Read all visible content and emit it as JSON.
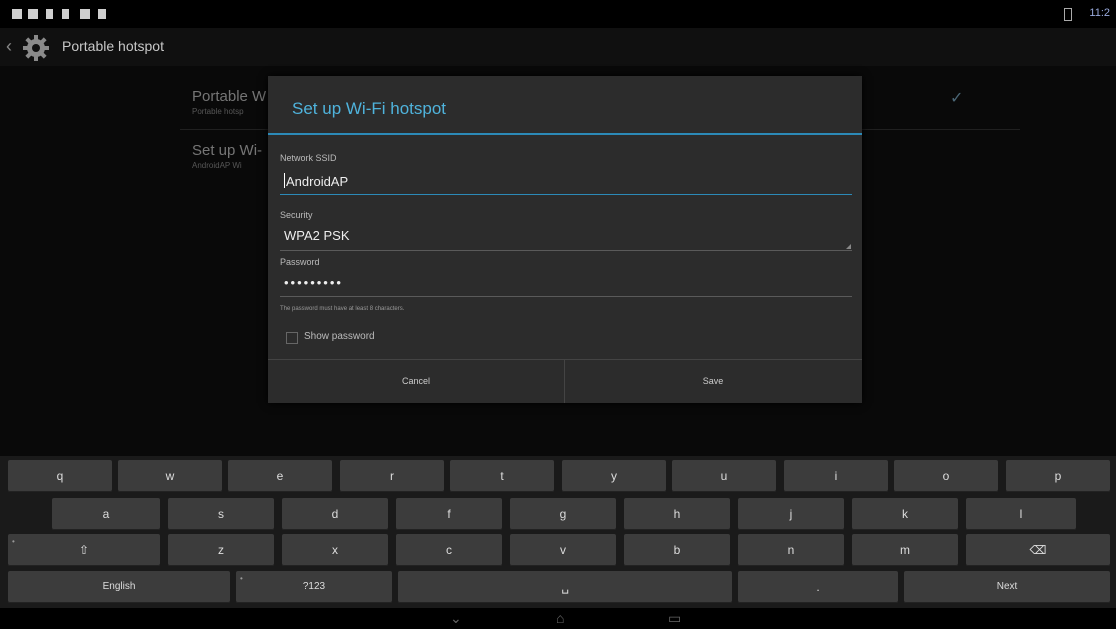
{
  "status_bar": {
    "time": "11:2"
  },
  "action_bar": {
    "title": "Portable hotspot"
  },
  "settings": [
    {
      "title": "Portable W",
      "subtitle": "Portable hotsp"
    },
    {
      "title": "Set up Wi-",
      "subtitle": "AndroidAP Wi"
    }
  ],
  "dialog": {
    "title": "Set up Wi-Fi hotspot",
    "ssid_label": "Network SSID",
    "ssid_value": "AndroidAP",
    "security_label": "Security",
    "security_value": "WPA2 PSK",
    "password_label": "Password",
    "password_value": "•••••••••",
    "hint": "The password must have at least 8 characters.",
    "show_password_label": "Show password",
    "cancel_label": "Cancel",
    "save_label": "Save"
  },
  "keyboard": {
    "row1": [
      "q",
      "w",
      "e",
      "r",
      "t",
      "y",
      "u",
      "i",
      "o",
      "p"
    ],
    "row2": [
      "a",
      "s",
      "d",
      "f",
      "g",
      "h",
      "j",
      "k",
      "l"
    ],
    "row3": [
      "z",
      "x",
      "c",
      "v",
      "b",
      "n",
      "m"
    ],
    "shift": "⇧",
    "delete": "⌫",
    "lang": "English",
    "symbols": "?123",
    "space": "␣",
    "period": ".",
    "next": "Next"
  },
  "nav": {
    "back": "⌄",
    "home": "⌂",
    "recents": "▭"
  }
}
